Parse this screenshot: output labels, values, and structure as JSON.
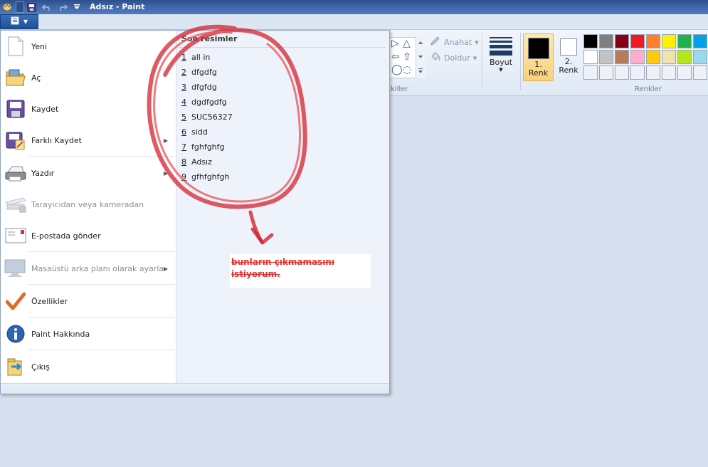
{
  "window": {
    "title": "Adsız - Paint"
  },
  "quick_access": [
    "paint-app-icon",
    "save-icon",
    "undo-icon",
    "redo-icon",
    "customize-dropdown-icon"
  ],
  "ribbon": {
    "shapes_group_label": "killer",
    "outline_label": "Anahat",
    "fill_label": "Doldur",
    "size_label": "Boyut",
    "color1_label_line1": "1.",
    "color1_label_line2": "Renk",
    "color2_label_line1": "2.",
    "color2_label_line2": "Renk",
    "colors_group_label": "Renkler",
    "color1_value": "#000000",
    "color2_value": "#ffffff",
    "palette": [
      "#000000",
      "#7f7f7f",
      "#880015",
      "#ed1c24",
      "#ff7f27",
      "#fff200",
      "#22b14c",
      "#00a2e8",
      "#ffffff",
      "#c3c3c3",
      "#b97a57",
      "#ffaec9",
      "#ffc90e",
      "#efe4b0",
      "#b5e61d",
      "#99d9ea",
      "#eef2f8",
      "#eef2f8",
      "#eef2f8",
      "#eef2f8",
      "#eef2f8",
      "#eef2f8",
      "#eef2f8",
      "#eef2f8"
    ]
  },
  "menu": {
    "items": [
      {
        "label": "Yeni",
        "icon": "new-file-icon",
        "disabled": false,
        "submenu": false
      },
      {
        "label": "Aç",
        "icon": "open-folder-icon",
        "disabled": false,
        "submenu": false
      },
      {
        "label": "Kaydet",
        "icon": "save-disk-icon",
        "disabled": false,
        "submenu": false
      },
      {
        "label": "Farklı Kaydet",
        "icon": "save-as-icon",
        "disabled": false,
        "submenu": true
      },
      {
        "label": "Yazdır",
        "icon": "printer-icon",
        "disabled": false,
        "submenu": true
      },
      {
        "label": "Tarayıcıdan veya kameradan",
        "icon": "scanner-icon",
        "disabled": true,
        "submenu": false
      },
      {
        "label": "E-postada gönder",
        "icon": "email-icon",
        "disabled": false,
        "submenu": false
      },
      {
        "label": "Masaüstü arka planı olarak ayarla",
        "icon": "desktop-background-icon",
        "disabled": true,
        "submenu": true
      },
      {
        "label": "Özellikler",
        "icon": "checkmark-icon",
        "disabled": false,
        "submenu": false
      },
      {
        "label": "Paint Hakkında",
        "icon": "info-icon",
        "disabled": false,
        "submenu": false
      },
      {
        "label": "Çıkış",
        "icon": "exit-icon",
        "disabled": false,
        "submenu": false
      }
    ],
    "recent_header": "Son resimler",
    "recent": [
      {
        "num": "1",
        "name": "all in"
      },
      {
        "num": "2",
        "name": "dfgdfg"
      },
      {
        "num": "3",
        "name": "dfgfdg"
      },
      {
        "num": "4",
        "name": "dgdfgdfg"
      },
      {
        "num": "5",
        "name": "SUC56327"
      },
      {
        "num": "6",
        "name": "sidd"
      },
      {
        "num": "7",
        "name": "fghfghfg"
      },
      {
        "num": "8",
        "name": "Adsız"
      },
      {
        "num": "9",
        "name": "gfhfghfgh"
      }
    ]
  },
  "annotation": {
    "text": "bunların çıkmamasını istiyorum.",
    "color": "#e23131"
  }
}
